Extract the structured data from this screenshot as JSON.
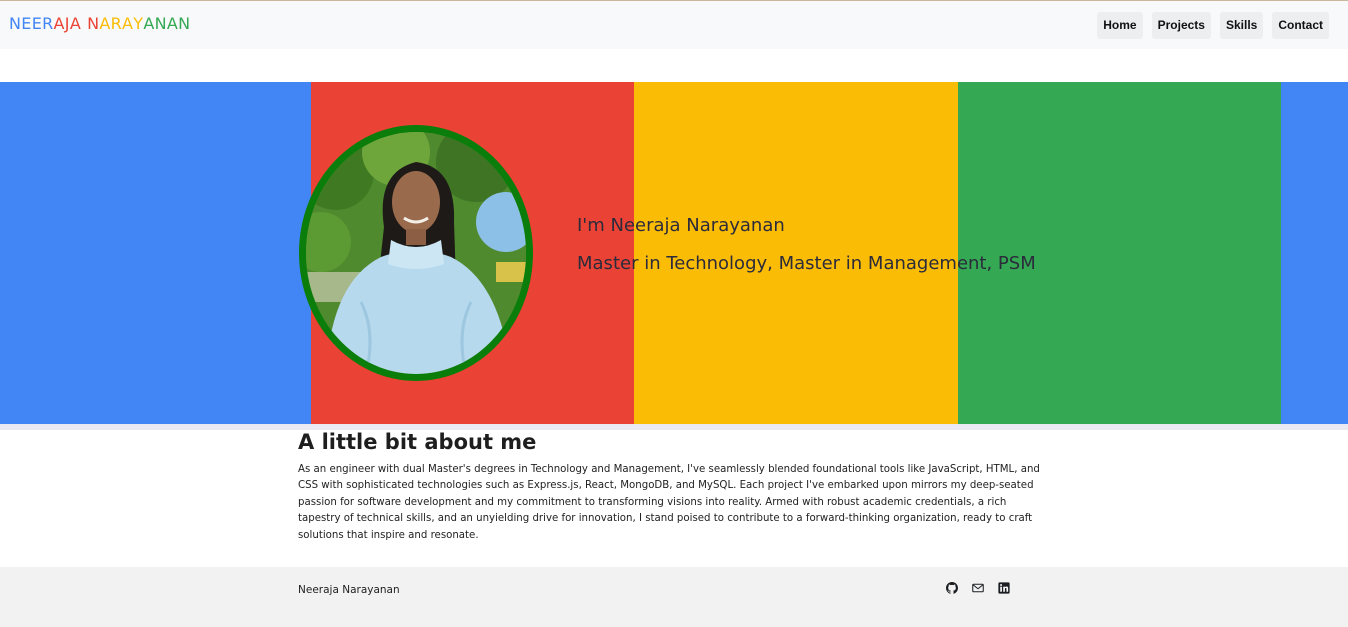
{
  "brand": {
    "letters": [
      {
        "ch": "N",
        "color": "#4285f4"
      },
      {
        "ch": "E",
        "color": "#4285f4"
      },
      {
        "ch": "E",
        "color": "#4285f4"
      },
      {
        "ch": "R",
        "color": "#4285f4"
      },
      {
        "ch": "A",
        "color": "#ea4335"
      },
      {
        "ch": "J",
        "color": "#ea4335"
      },
      {
        "ch": "A",
        "color": "#ea4335"
      },
      {
        "ch": " ",
        "color": "#ffffff"
      },
      {
        "ch": "N",
        "color": "#ea4335"
      },
      {
        "ch": "A",
        "color": "#fbbc05"
      },
      {
        "ch": "R",
        "color": "#fbbc05"
      },
      {
        "ch": "A",
        "color": "#fbbc05"
      },
      {
        "ch": "Y",
        "color": "#fbbc05"
      },
      {
        "ch": "A",
        "color": "#34a853"
      },
      {
        "ch": "N",
        "color": "#34a853"
      },
      {
        "ch": "A",
        "color": "#34a853"
      },
      {
        "ch": "N",
        "color": "#34a853"
      }
    ]
  },
  "nav": {
    "home": "Home",
    "projects": "Projects",
    "skills": "Skills",
    "contact": "Contact"
  },
  "hero": {
    "colors": {
      "blue": "#4285f4",
      "red": "#ea4335",
      "yellow": "#fbbc05",
      "green": "#34a853",
      "frame": "#0a7d0a"
    },
    "name_line": "I'm Neeraja Narayanan",
    "title_line": "Master in Technology, Master in Management, PSM"
  },
  "about": {
    "heading": "A little bit about me",
    "text": "As an engineer with dual Master's degrees in Technology and Management, I've seamlessly blended foundational tools like JavaScript, HTML, and CSS with sophisticated technologies such as Express.js, React, MongoDB, and MySQL. Each project I've embarked upon mirrors my deep-seated passion for software development and my commitment to transforming visions into reality. Armed with robust academic credentials, a rich tapestry of technical skills, and an unyielding drive for innovation, I stand poised to contribute to a forward-thinking organization, ready to craft solutions that inspire and resonate."
  },
  "footer": {
    "name": "Neeraja Narayanan",
    "icons": [
      "github-icon",
      "mail-icon",
      "linkedin-icon"
    ]
  }
}
